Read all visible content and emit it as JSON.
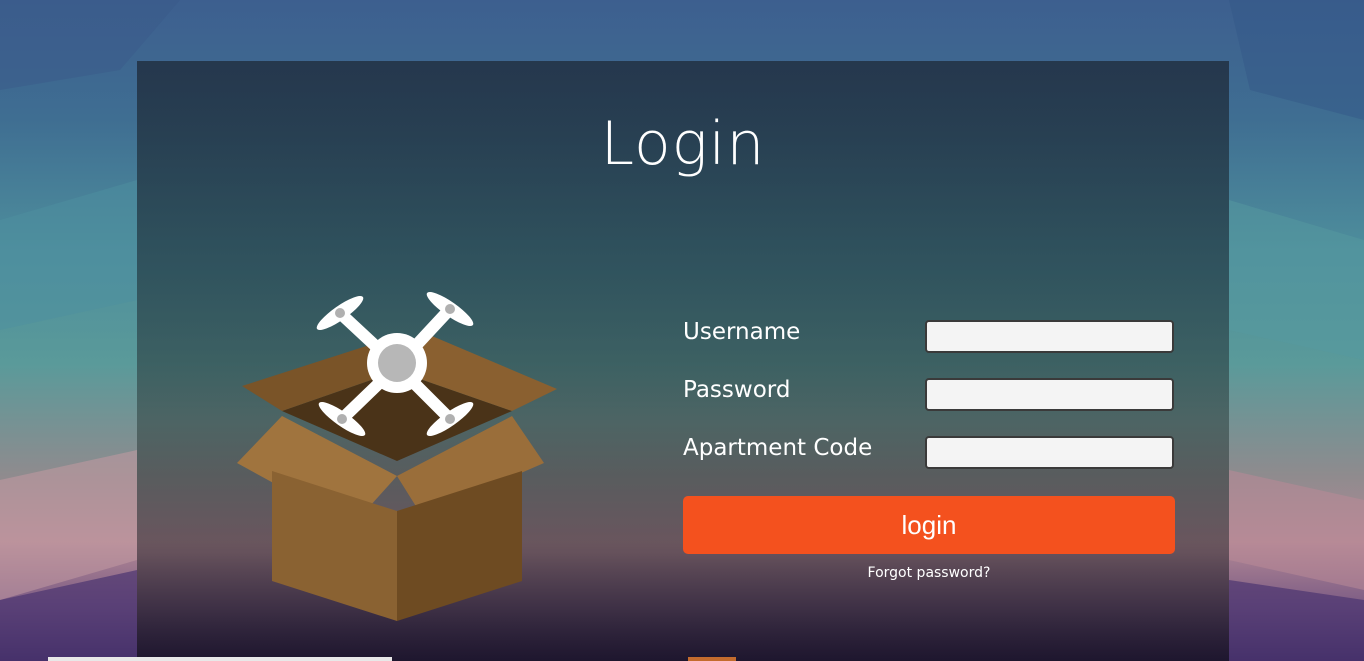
{
  "page": {
    "title": "Login"
  },
  "form": {
    "fields": [
      {
        "label": "Username",
        "value": "",
        "placeholder": ""
      },
      {
        "label": "Password",
        "value": "",
        "placeholder": ""
      },
      {
        "label": "Apartment Code",
        "value": "",
        "placeholder": ""
      }
    ],
    "login_button": "login",
    "forgot_link": "Forgot password?"
  },
  "colors": {
    "accent": "#f4511e",
    "panel": "#1e2a3a",
    "text": "#ffffff"
  },
  "icons": {
    "illustration": "drone-box-illustration"
  }
}
